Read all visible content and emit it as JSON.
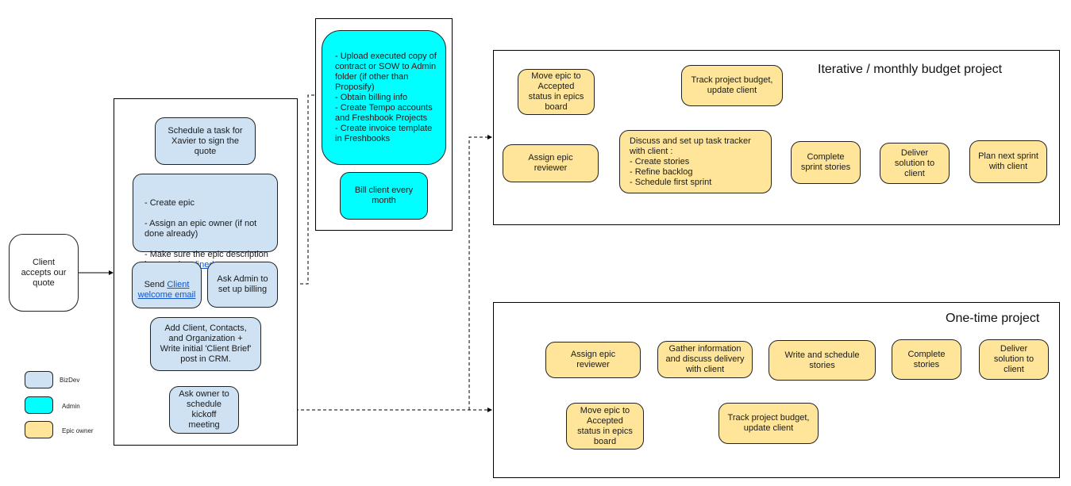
{
  "start": {
    "label": "Client\naccepts our\nquote"
  },
  "bizdev_column": {
    "schedule_task": "Schedule a task for\nXavier to sign the\nquote",
    "create_epic": {
      "line1": "- Create epic",
      "line2": "- Assign an epic owner (if not done already)",
      "line3_prefix": "- Make sure the epic description is ",
      "line3_link": "properly refined"
    },
    "send_email": {
      "prefix": "Send ",
      "link": "Client welcome email"
    },
    "ask_admin": "Ask Admin to\nset up billing",
    "add_client": "Add Client, Contacts,\nand Organization +\nWrite initial 'Client Brief'\npost in CRM.",
    "ask_owner": "Ask owner to\nschedule\nkickoff\nmeeting"
  },
  "admin_column": {
    "upload_tasks": "- Upload executed copy of contract or SOW to Admin folder (if other than Proposify)\n- Obtain billing info\n- Create Tempo accounts and Freshbook Projects\n- Create invoice template in Freshbooks",
    "bill_client": "Bill client every\nmonth"
  },
  "iterative_panel": {
    "title": "Iterative / monthly budget project",
    "move_epic": "Move epic to\nAccepted\nstatus in epics\nboard",
    "track_budget": "Track project budget,\nupdate client",
    "assign_reviewer": "Assign epic\nreviewer",
    "discuss_tracker": "Discuss and set up task tracker\nwith client :\n- Create stories\n- Refine backlog\n- Schedule first sprint",
    "complete_sprint": "Complete\nsprint stories",
    "deliver_solution": "Deliver\nsolution to\nclient",
    "plan_next_sprint": "Plan next sprint\nwith client"
  },
  "onetime_panel": {
    "title": "One-time project",
    "assign_reviewer": "Assign epic\nreviewer",
    "gather_info": "Gather information\nand discuss delivery\nwith client",
    "write_stories": "Write and schedule\nstories",
    "complete_stories": "Complete\nstories",
    "deliver_solution": "Deliver\nsolution to\nclient",
    "move_epic": "Move epic to\nAccepted\nstatus in epics\nboard",
    "track_budget": "Track project budget,\nupdate client"
  },
  "legend": {
    "items": [
      {
        "label": "BizDev",
        "color": "#cfe2f3"
      },
      {
        "label": "Admin",
        "color": "#00ffff"
      },
      {
        "label": "Epic owner",
        "color": "#ffe599"
      }
    ]
  }
}
